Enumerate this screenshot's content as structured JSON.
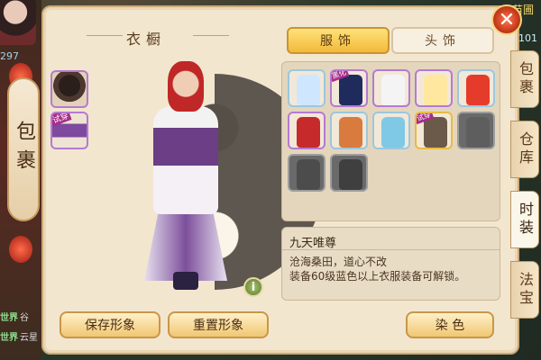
{
  "window": {
    "title": "衣橱",
    "close_icon": "close-icon"
  },
  "hud": {
    "left_number": "297",
    "top_right_text": "苗圃",
    "top_right_number": "101"
  },
  "left_chat": [
    {
      "channel": "世界",
      "text": "谷"
    },
    {
      "channel": "世界",
      "text": "云星"
    }
  ],
  "bag_tab": {
    "label": "包裹"
  },
  "side_tabs": [
    {
      "label": "包裹",
      "active": false
    },
    {
      "label": "仓库",
      "active": false
    },
    {
      "label": "时装",
      "active": true
    },
    {
      "label": "法宝",
      "active": false
    }
  ],
  "left_slots": [
    {
      "type": "hair",
      "badge": ""
    },
    {
      "type": "outfit",
      "badge": "试穿"
    }
  ],
  "tabs": [
    {
      "label": "服饰",
      "active": true
    },
    {
      "label": "头饰",
      "active": false
    }
  ],
  "items": [
    {
      "color": "#cfe6ff",
      "frame": "blue",
      "badge": ""
    },
    {
      "color": "#1f2b5c",
      "frame": "purple",
      "badge": "黑化"
    },
    {
      "color": "#f4f4f4",
      "frame": "purple",
      "badge": ""
    },
    {
      "color": "#ffe7a0",
      "frame": "purple",
      "badge": ""
    },
    {
      "color": "#e53b2b",
      "frame": "blue",
      "badge": ""
    },
    {
      "color": "#c72a2a",
      "frame": "purple",
      "badge": ""
    },
    {
      "color": "#d97a3e",
      "frame": "blue",
      "badge": ""
    },
    {
      "color": "#7fc8e6",
      "frame": "blue",
      "badge": ""
    },
    {
      "color": "#6b5a4a",
      "frame": "gold",
      "badge": "试穿"
    },
    {
      "color": "#5e5e5e",
      "frame": "gray",
      "badge": ""
    },
    {
      "color": "#4c4c4c",
      "frame": "gray",
      "badge": ""
    },
    {
      "color": "#3f3f3f",
      "frame": "gray",
      "badge": ""
    }
  ],
  "description": {
    "name": "九天唯尊",
    "text": "沧海桑田，道心不改\n装备60级蓝色以上衣服装备可解锁。"
  },
  "buttons": {
    "save": "保存形象",
    "reset": "重置形象",
    "dye": "染 色"
  },
  "info_icon": "i"
}
